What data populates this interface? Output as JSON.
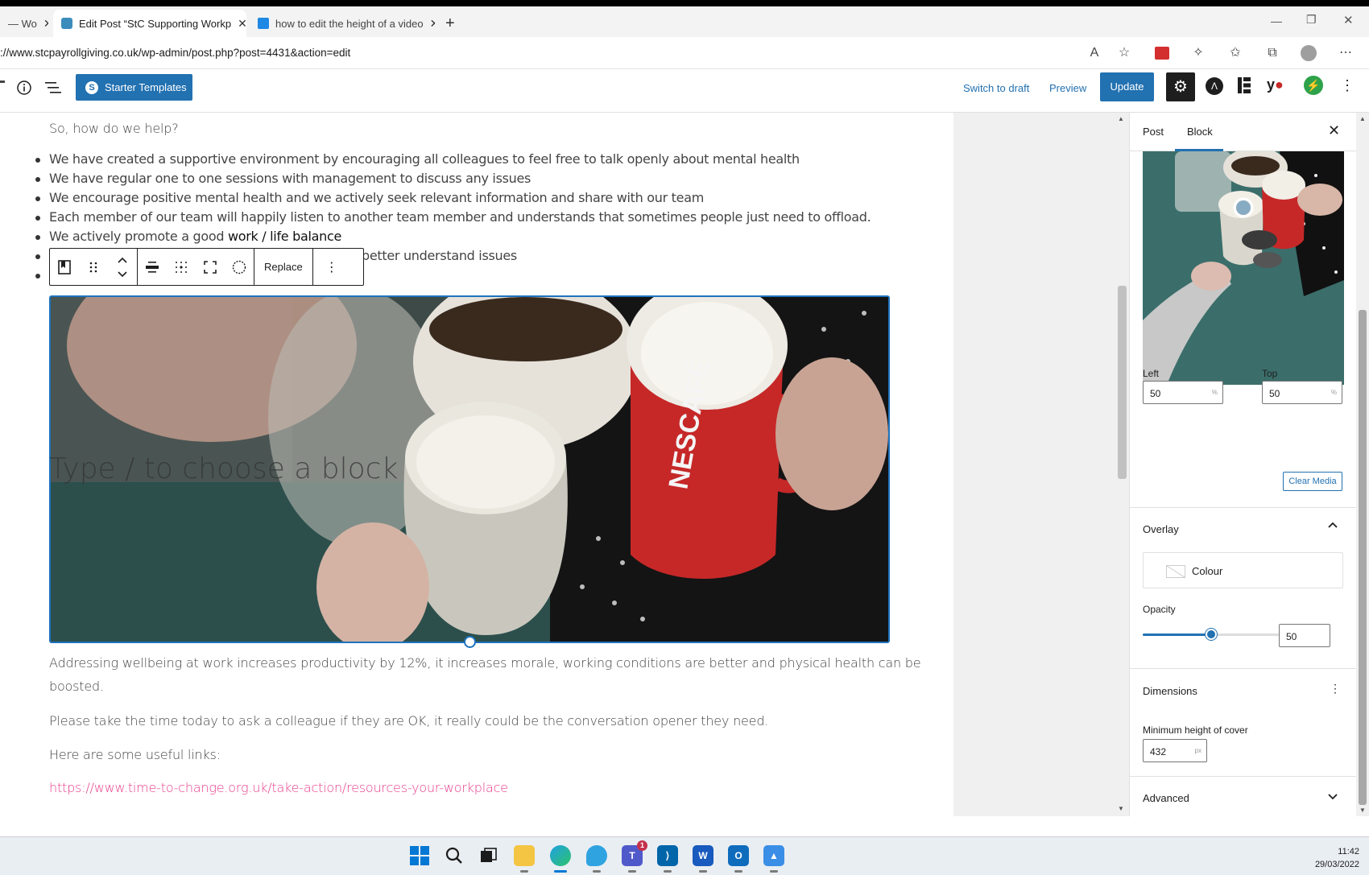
{
  "browser": {
    "tabs": [
      {
        "label": "— Wo",
        "active": false
      },
      {
        "label": "Edit Post “StC Supporting Workp",
        "active": true
      },
      {
        "label": "how to edit the height of a video",
        "active": false
      }
    ],
    "url": "://www.stcpayrollgiving.co.uk/wp-admin/post.php?post=4431&action=edit"
  },
  "header": {
    "starter_templates": "Starter Templates",
    "switch_to_draft": "Switch to draft",
    "preview": "Preview",
    "update": "Update"
  },
  "content": {
    "intro": "So, how do we help?",
    "bullets": [
      "We have created a supportive environment by encouraging all colleagues to feel free to talk openly about mental health",
      "We have regular one to one sessions with management to discuss any issues",
      "We encourage positive mental health and we actively seek relevant information and share with our team",
      "Each member of our team will happily listen to another team member and understands that sometimes people just need to offload."
    ],
    "bullet5_prefix": "We actively promote a good ",
    "bullet5_link": "work / life balance",
    "bullet6_fragment": "better understand issues",
    "toolbar_replace": "Replace",
    "cover_placeholder": "Type / to choose a block",
    "para1": "Addressing wellbeing at work increases productivity by 12%, it increases morale, working conditions are better and physical health can be",
    "para1_cont": "boosted.",
    "para2": "Please take the time today to ask a colleague if they are OK, it really could be the conversation opener they need.",
    "para3": "Here are some useful links:",
    "link1": "https://www.time-to-change.org.uk/take-action/resources-your-workplace"
  },
  "sidebar": {
    "tab_post": "Post",
    "tab_block": "Block",
    "left_label": "Left",
    "left_value": "50",
    "top_label": "Top",
    "top_value": "50",
    "unit_percent": "%",
    "clear_media": "Clear Media",
    "overlay_title": "Overlay",
    "colour_label": "Colour",
    "opacity_label": "Opacity",
    "opacity_value": "50",
    "opacity_fraction": 0.5,
    "dimensions_title": "Dimensions",
    "min_height_label": "Minimum height of cover",
    "min_height_value": "432",
    "unit_px": "px",
    "advanced_title": "Advanced"
  },
  "taskbar": {
    "time": "11:42",
    "date": "29/03/2022",
    "teams_badge": "1"
  },
  "colors": {
    "accent": "#2271b1",
    "link_pink": "#e83e8c",
    "selection_border": "#1e73be"
  }
}
